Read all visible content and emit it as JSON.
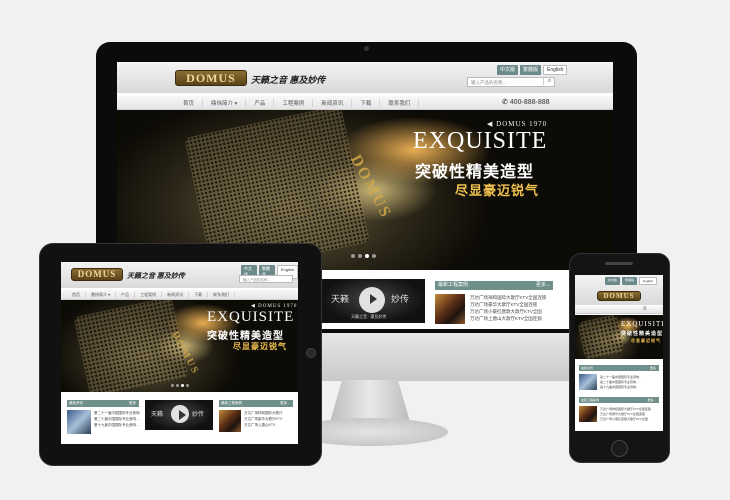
{
  "site": {
    "logo": "DOMUS",
    "slogan": "天籁之音 惠及妙传",
    "lang_chinese": "中文版",
    "lang_traditional": "繁體版",
    "lang_english": "English",
    "search_placeholder": "输入产品的名称...",
    "phone": "400-888-888"
  },
  "nav": [
    "首页",
    "鼎炜简介 ▾",
    "产品",
    "工程案例",
    "新闻资讯",
    "下载",
    "联系我们"
  ],
  "banner": {
    "brand_side": "DOMUS",
    "tag": "◀ DOMUS 1970",
    "headline": "EXQUISITE",
    "cn_line1": "突破性精美造型",
    "cn_line2": "尽显豪迈锐气"
  },
  "video": {
    "left": "天籁",
    "right": "妙传",
    "caption": "天籁之音 · 惠及妙传"
  },
  "panel_cases": {
    "title": "最新工程案例",
    "more": "更多...",
    "items": [
      "万达广场祥和国际大歌厅KTV全国连锁",
      "万达广场豪华大歌厅KTV全国连锁",
      "万达广场小豪红唐歌大歌厅KTV全国",
      "万达广场上唐山大歌厅KTV全国连锁"
    ]
  },
  "panel_news": {
    "title": "最新资讯",
    "more": "更多",
    "items": [
      "第二十一届中国国际专业音响...",
      "第二十届中国国际专业音响...",
      "第十九届中国国际专业音响..."
    ]
  },
  "tablet_cases": [
    "万达广场祥和国际大歌厅",
    "万达广场豪华大歌厅KTV",
    "万达广场上唐山KTV"
  ],
  "phone_nav": "≡"
}
